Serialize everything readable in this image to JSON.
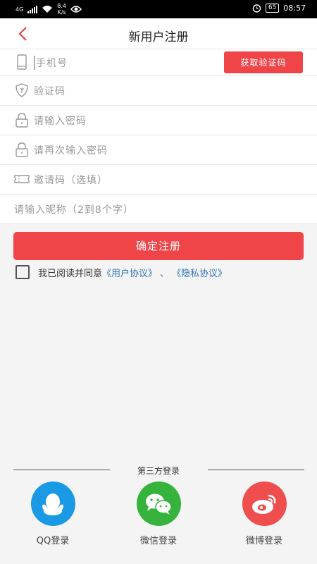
{
  "status_bar": {
    "network": "4G",
    "speed_value": "8.4",
    "speed_unit": "K/s",
    "battery": "65",
    "time": "08:57"
  },
  "header": {
    "title": "新用户注册"
  },
  "form": {
    "phone_placeholder": "手机号",
    "get_code_label": "获取验证码",
    "code_placeholder": "验证码",
    "password_placeholder": "请输入密码",
    "password_confirm_placeholder": "请再次输入密码",
    "invite_placeholder": "邀请码（选填）",
    "nickname_placeholder": "请输入昵称（2到8个字）"
  },
  "submit_label": "确定注册",
  "agreement": {
    "prefix": "我已阅读并同意",
    "user_agreement": "《用户协议》",
    "separator": "、",
    "privacy_agreement": "《隐私协议》"
  },
  "third_party": {
    "heading": "第三方登录",
    "items": [
      {
        "label": "QQ登录",
        "icon": "qq-icon",
        "color": "#1a9ae4"
      },
      {
        "label": "微信登录",
        "icon": "wechat-icon",
        "color": "#35b33c"
      },
      {
        "label": "微博登录",
        "icon": "weibo-icon",
        "color": "#ee4e4e"
      }
    ]
  },
  "colors": {
    "accent": "#ef4549",
    "link": "#2e74b5"
  }
}
